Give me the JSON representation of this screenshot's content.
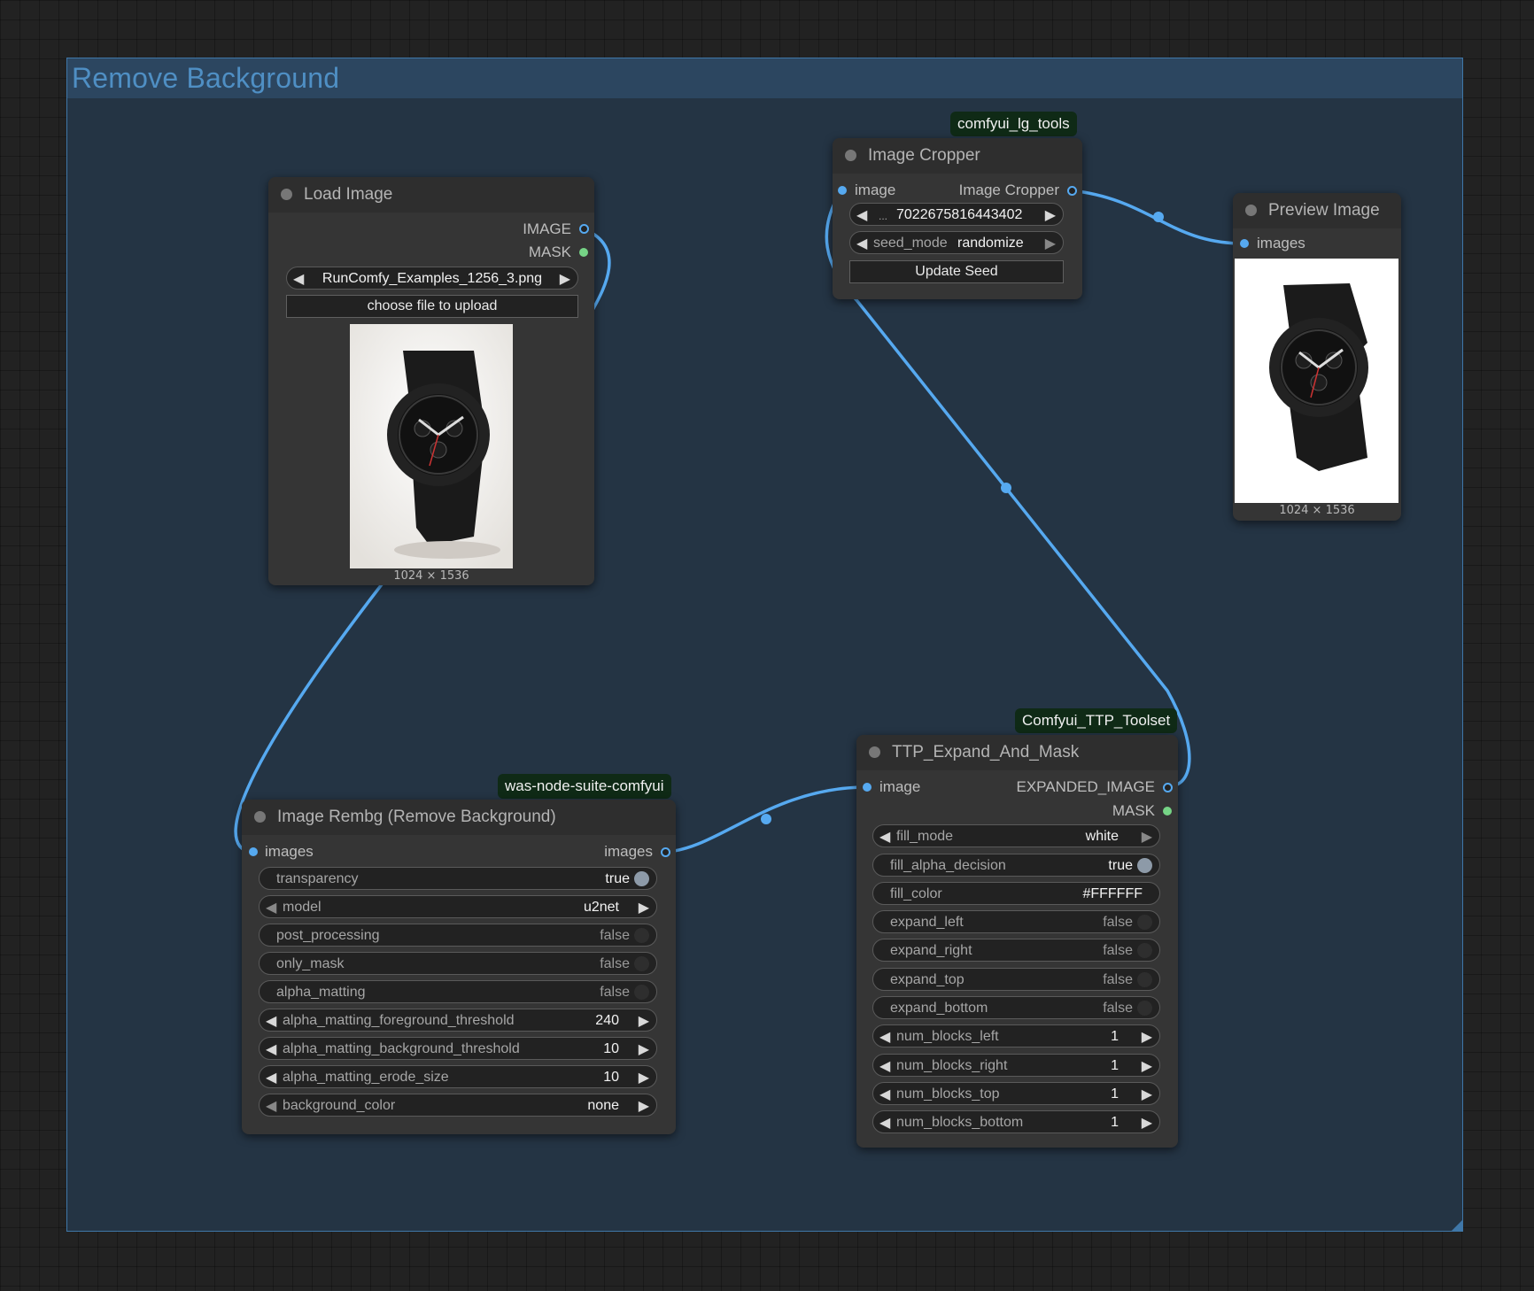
{
  "group": {
    "title": "Remove Background"
  },
  "load_image": {
    "title": "Load Image",
    "outputs": [
      "IMAGE",
      "MASK"
    ],
    "file": "RunComfy_Examples_1256_3.png",
    "upload_label": "choose file to upload",
    "image_size": "1024 × 1536"
  },
  "image_cropper": {
    "badge": "comfyui_lg_tools",
    "title": "Image Cropper",
    "input": "image",
    "output": "Image Cropper",
    "seed_prefix": "...",
    "seed": "7022675816443402",
    "seed_mode_label": "seed_mode",
    "seed_mode_value": "randomize",
    "update_label": "Update Seed"
  },
  "preview_image": {
    "title": "Preview Image",
    "input": "images",
    "image_size": "1024 × 1536"
  },
  "rembg": {
    "badge": "was-node-suite-comfyui",
    "title": "Image Rembg (Remove Background)",
    "input": "images",
    "output": "images",
    "widgets": [
      {
        "label": "transparency",
        "value": "true"
      },
      {
        "label": "model",
        "value": "u2net"
      },
      {
        "label": "post_processing",
        "value": "false"
      },
      {
        "label": "only_mask",
        "value": "false"
      },
      {
        "label": "alpha_matting",
        "value": "false"
      },
      {
        "label": "alpha_matting_foreground_threshold",
        "value": "240"
      },
      {
        "label": "alpha_matting_background_threshold",
        "value": "10"
      },
      {
        "label": "alpha_matting_erode_size",
        "value": "10"
      },
      {
        "label": "background_color",
        "value": "none"
      }
    ]
  },
  "ttp": {
    "badge": "Comfyui_TTP_Toolset",
    "title": "TTP_Expand_And_Mask",
    "input": "image",
    "outputs": [
      "EXPANDED_IMAGE",
      "MASK"
    ],
    "widgets": [
      {
        "label": "fill_mode",
        "value": "white"
      },
      {
        "label": "fill_alpha_decision",
        "value": "true"
      },
      {
        "label": "fill_color",
        "value": "#FFFFFF"
      },
      {
        "label": "expand_left",
        "value": "false"
      },
      {
        "label": "expand_right",
        "value": "false"
      },
      {
        "label": "expand_top",
        "value": "false"
      },
      {
        "label": "expand_bottom",
        "value": "false"
      },
      {
        "label": "num_blocks_left",
        "value": "1"
      },
      {
        "label": "num_blocks_right",
        "value": "1"
      },
      {
        "label": "num_blocks_top",
        "value": "1"
      },
      {
        "label": "num_blocks_bottom",
        "value": "1"
      }
    ]
  },
  "colors": {
    "link": "#56a9f0",
    "group_border": "#3f77a8",
    "badge_bg": "#0f2a16"
  }
}
